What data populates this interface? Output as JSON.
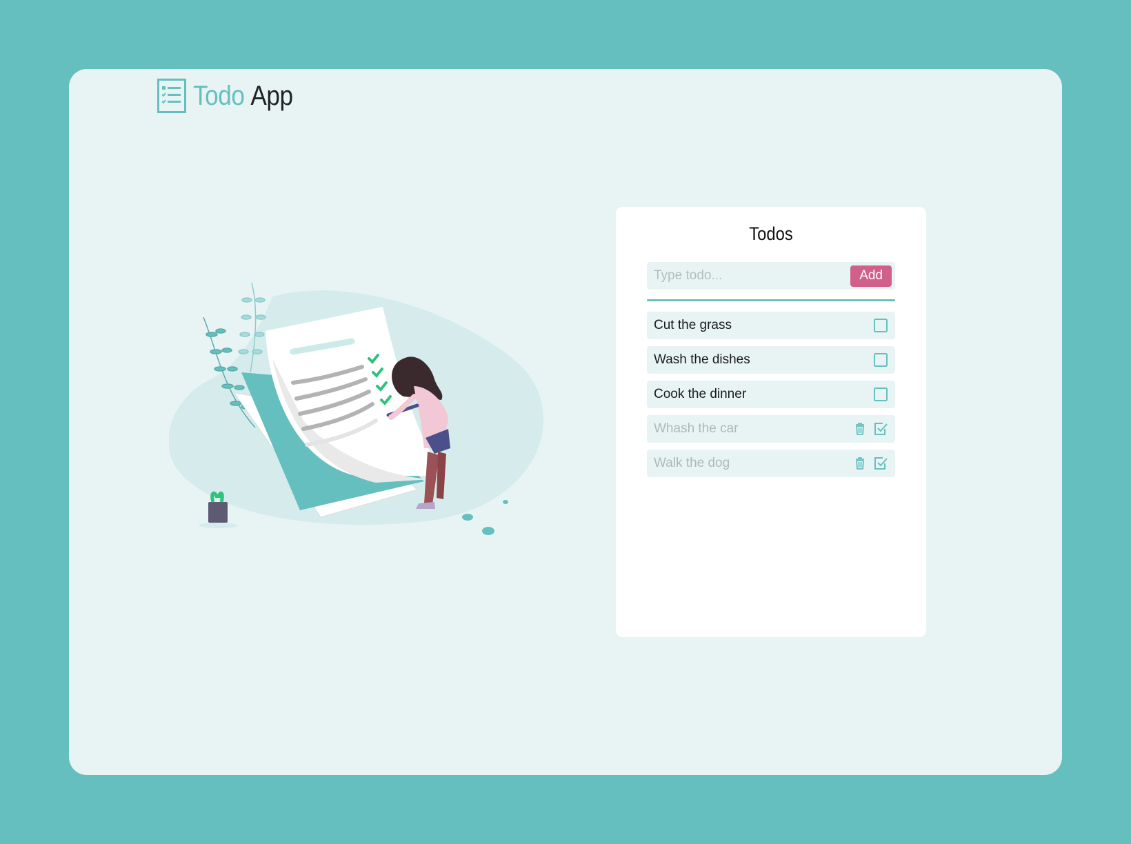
{
  "brand": {
    "word1": "Todo",
    "word2": "App",
    "icon": "checklist-icon"
  },
  "todos_panel": {
    "title": "Todos",
    "input": {
      "placeholder": "Type todo...",
      "value": ""
    },
    "add_label": "Add",
    "items": [
      {
        "text": "Cut the grass",
        "done": false
      },
      {
        "text": "Wash the dishes",
        "done": false
      },
      {
        "text": "Cook the dinner",
        "done": false
      },
      {
        "text": "Whash the car",
        "done": true
      },
      {
        "text": "Walk the dog",
        "done": true
      }
    ]
  },
  "colors": {
    "page_bg": "#66bfbf",
    "card_bg": "#e8f4f4",
    "accent": "#66bfbf",
    "add_button": "#d0608a"
  }
}
